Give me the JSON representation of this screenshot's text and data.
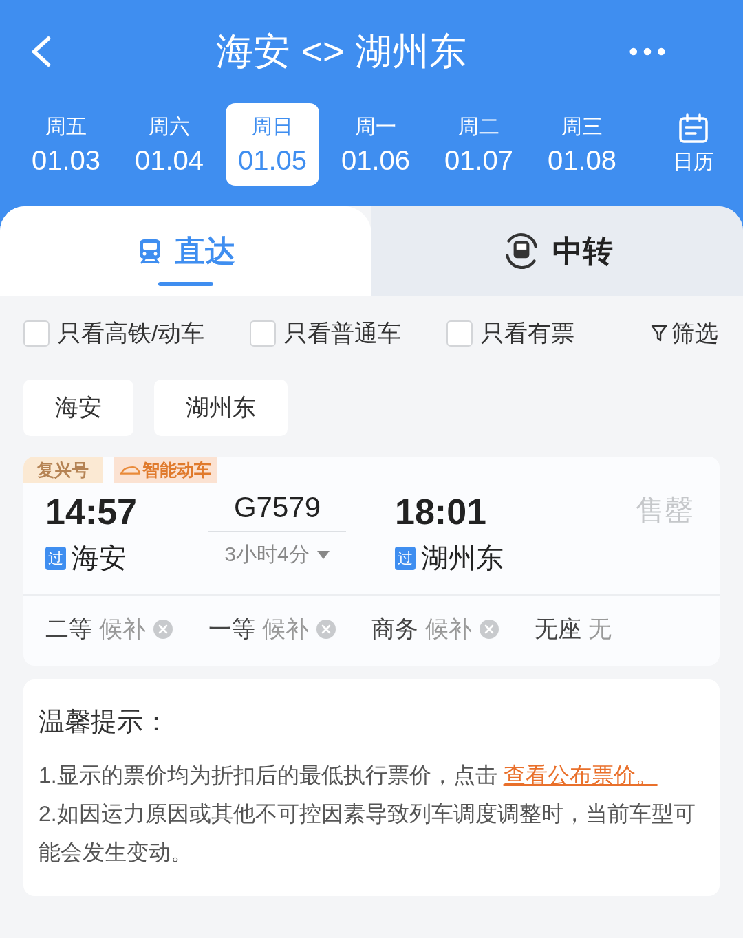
{
  "header": {
    "title": "海安 <> 湖州东"
  },
  "dates": [
    {
      "weekday": "周五",
      "date": "01.03",
      "selected": false
    },
    {
      "weekday": "周六",
      "date": "01.04",
      "selected": false
    },
    {
      "weekday": "周日",
      "date": "01.05",
      "selected": true
    },
    {
      "weekday": "周一",
      "date": "01.06",
      "selected": false
    },
    {
      "weekday": "周二",
      "date": "01.07",
      "selected": false
    },
    {
      "weekday": "周三",
      "date": "01.08",
      "selected": false
    }
  ],
  "calendar_label": "日历",
  "tabs": [
    {
      "label": "直达",
      "kind": "direct",
      "selected": true
    },
    {
      "label": "中转",
      "kind": "transfer",
      "selected": false
    }
  ],
  "filters": [
    {
      "label": "只看高铁/动车",
      "checked": false
    },
    {
      "label": "只看普通车",
      "checked": false
    },
    {
      "label": "只看有票",
      "checked": false
    }
  ],
  "filter_button": "筛选",
  "stations": [
    "海安",
    "湖州东"
  ],
  "train": {
    "tags": [
      {
        "label": "复兴号",
        "kind": "plain"
      },
      {
        "label": "智能动车",
        "kind": "smart"
      }
    ],
    "depart_time": "14:57",
    "number": "G7579",
    "arrive_time": "18:01",
    "depart_badge": "过",
    "depart_station": "海安",
    "duration": "3小时4分",
    "arrive_badge": "过",
    "arrive_station": "湖州东",
    "status": "售罄",
    "seats": [
      {
        "class": "二等",
        "availability": "候补",
        "closed": true
      },
      {
        "class": "一等",
        "availability": "候补",
        "closed": true
      },
      {
        "class": "商务",
        "availability": "候补",
        "closed": true
      },
      {
        "class": "无座",
        "availability": "无",
        "closed": false
      }
    ]
  },
  "notice": {
    "title": "温馨提示：",
    "items": [
      {
        "text": "1.显示的票价均为折扣后的最低执行票价，点击 ",
        "link": "查看公布票价。"
      },
      {
        "text": "2.如因运力原因或其他不可控因素导致列车调度调整时，当前车型可能会发生变动。"
      }
    ]
  }
}
